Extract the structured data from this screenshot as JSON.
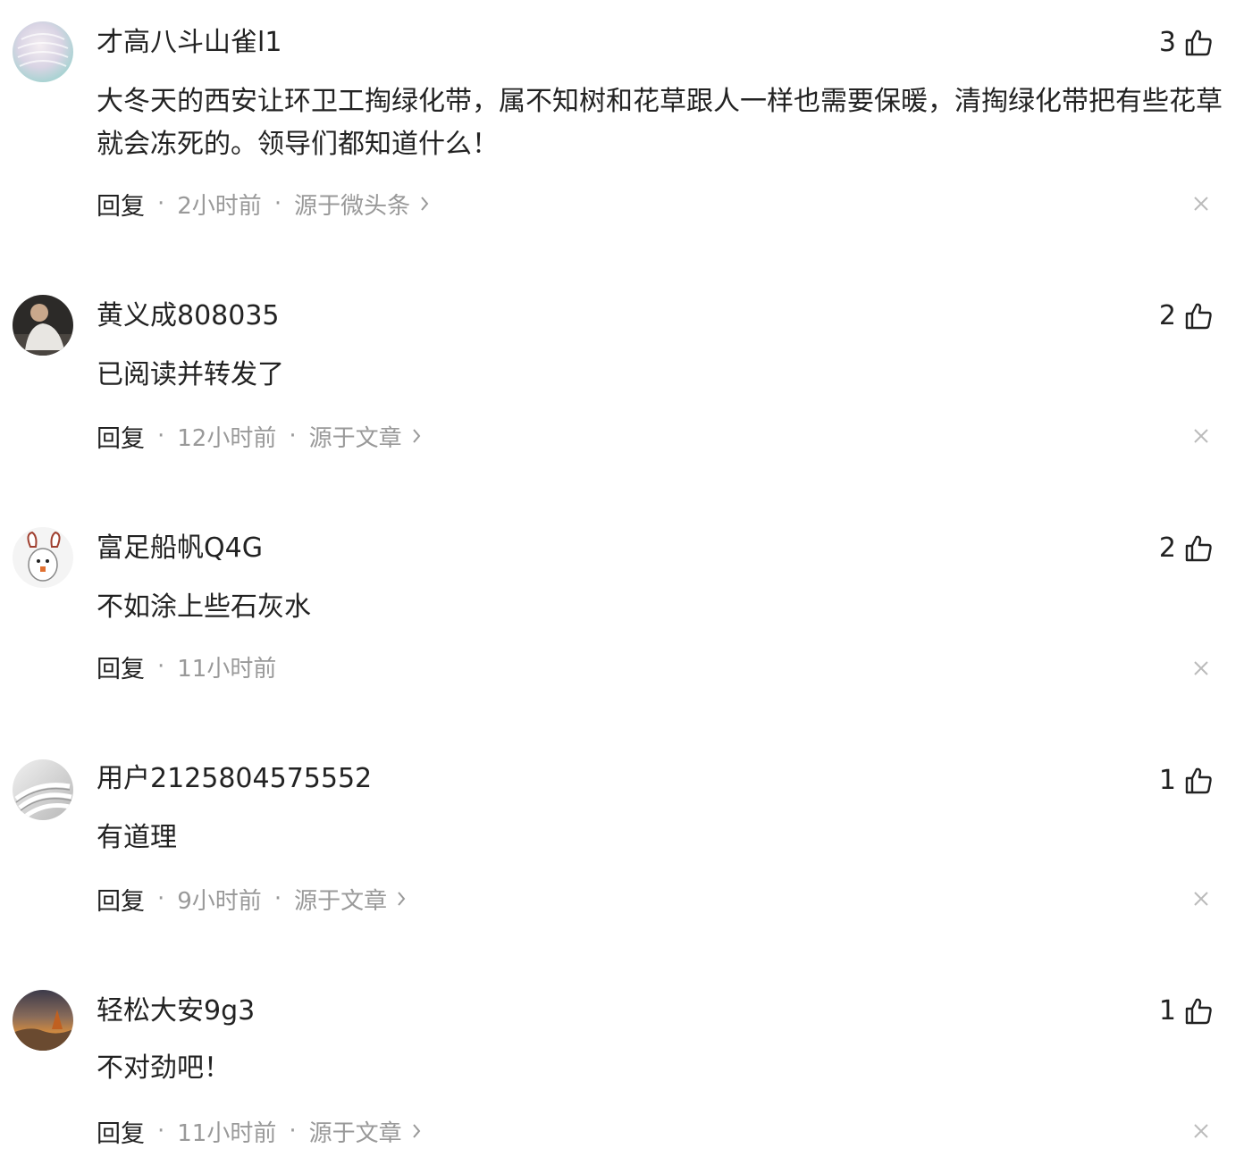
{
  "comments": [
    {
      "username": "才高八斗山雀l1",
      "likes": "3",
      "text": "大冬天的西安让环卫工掏绿化带，属不知树和花草跟人一样也需要保暖，清掏绿化带把有些花草就会冻死的。领导们都知道什么！",
      "reply_label": "回复",
      "time": "2小时前",
      "source": "源于微头条"
    },
    {
      "username": "黄义成808035",
      "likes": "2",
      "text": "已阅读并转发了",
      "reply_label": "回复",
      "time": "12小时前",
      "source": "源于文章"
    },
    {
      "username": "富足船帆Q4G",
      "likes": "2",
      "text": "不如涂上些石灰水",
      "reply_label": "回复",
      "time": "11小时前"
    },
    {
      "username": "用户2125804575552",
      "likes": "1",
      "text": "有道理",
      "reply_label": "回复",
      "time": "9小时前",
      "source": "源于文章"
    },
    {
      "username": "轻松大安9g3",
      "likes": "1",
      "text": "不对劲吧！",
      "reply_label": "回复",
      "time": "11小时前",
      "source": "源于文章"
    }
  ],
  "separator": "·",
  "icons": {
    "like": "thumbs-up-icon",
    "more": "chevron-right-icon",
    "dismiss": "close-icon"
  }
}
